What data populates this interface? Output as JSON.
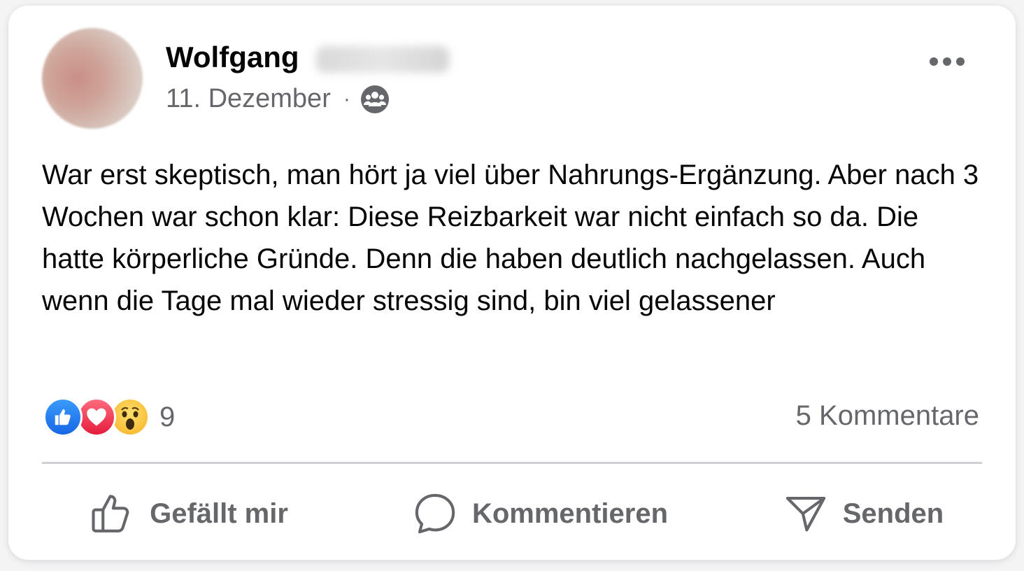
{
  "post": {
    "author": "Wolfgang",
    "date": "11. Dezember",
    "separator": "·",
    "audience_icon": "friends-icon",
    "text": "War erst skeptisch, man hört ja viel über Nahrungs-Ergänzung. Aber nach 3 Wochen war schon klar: Diese Reizbarkeit war nicht einfach so da. Die hatte körperliche Gründe. Denn die haben deutlich nachgelassen. Auch wenn die Tage mal wieder stressig sind, bin viel gelassener"
  },
  "stats": {
    "reaction_count": "9",
    "reactions": [
      "like",
      "love",
      "wow"
    ],
    "comments": "5 Kommentare"
  },
  "actions": {
    "like_label": "Gefällt mir",
    "comment_label": "Kommentieren",
    "send_label": "Senden"
  },
  "colors": {
    "secondary_text": "#65676b",
    "primary_text": "#050505",
    "like_blue": "#1877f2",
    "love_red": "#f33e58",
    "wow_yellow": "#f7b125",
    "divider": "#ced0d4"
  }
}
